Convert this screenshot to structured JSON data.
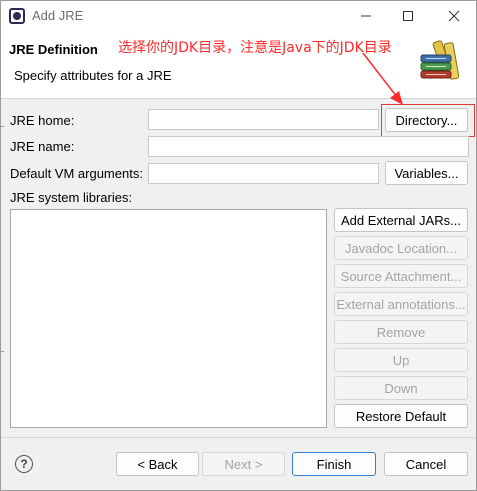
{
  "window": {
    "title": "Add JRE",
    "controls": {
      "minimize": "minimize",
      "maximize": "maximize",
      "close": "close"
    }
  },
  "header": {
    "title": "JRE Definition",
    "description": "Specify attributes for a JRE",
    "annotation": "选择你的JDK目录，注意是Java下的JDK目录"
  },
  "form": {
    "jre_home_label": "JRE home:",
    "jre_home_value": "",
    "directory_button": "Directory...",
    "jre_name_label": "JRE name:",
    "jre_name_value": "",
    "vm_args_label": "Default VM arguments:",
    "vm_args_value": "",
    "variables_button": "Variables...",
    "libraries_label": "JRE system libraries:"
  },
  "library_buttons": {
    "add_external_jars": "Add External JARs...",
    "javadoc_location": "Javadoc Location...",
    "source_attachment": "Source Attachment...",
    "external_annotations": "External annotations...",
    "remove": "Remove",
    "up": "Up",
    "down": "Down",
    "restore_default": "Restore Default"
  },
  "footer": {
    "help": "?",
    "back": "< Back",
    "next": "Next >",
    "finish": "Finish",
    "cancel": "Cancel"
  },
  "colors": {
    "annotation": "#ff2a2a",
    "primary_border": "#2f7ed8"
  }
}
